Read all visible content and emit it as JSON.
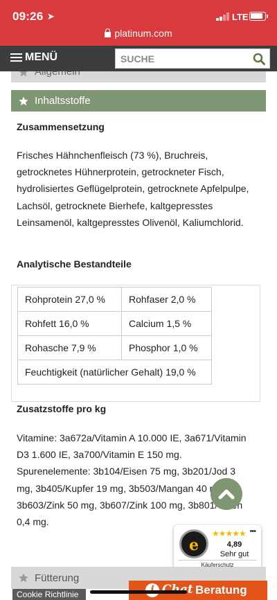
{
  "status_bar": {
    "time": "09:26",
    "location_glyph": "➤",
    "network": "LTE"
  },
  "browser": {
    "url": "platinum.com"
  },
  "nav": {
    "menu_label": "MENÜ",
    "search_placeholder": "SUCHE"
  },
  "accordion": {
    "allgemein": "Allgemein",
    "inhaltsstoffe": "Inhaltsstoffe",
    "fuetterung": "Fütterung"
  },
  "zusammensetzung": {
    "heading": "Zusammensetzung",
    "text": "Frisches Hähnchenfleisch (73 %), Bruchreis, getrocknetes Hühnerprotein, getrockneter Fisch, hydrolisiertes Geflügelprotein, getrocknete Apfelpulpe, Lachsöl, getrocknete Bierhefe, kaltgepresstes Leinsamenöl, kaltgepresstes Olivenöl, Kaliumchlorid."
  },
  "analytische": {
    "heading": "Analytische Bestandteile",
    "rows": [
      [
        "Rohprotein 27,0 %",
        "Rohfaser 2,0 %"
      ],
      [
        "Rohfett 16,0 %",
        "Calcium 1,5 %"
      ],
      [
        "Rohasche 7,9 %",
        "Phosphor 1,0 %"
      ]
    ],
    "full_row": "Feuchtigkeit (natürlicher Gehalt) 19,0 %"
  },
  "zusatzstoffe": {
    "heading": "Zusatzstoffe pro kg",
    "text": "Vitamine: 3a672a/Vitamin A 10.000 IE, 3a671/Vitamin D3 1.600 IE, 3a700/Vitamin E 150 mg. Spurenelemente: 3b104/Eisen 75 mg, 3b201/Jod 3 mg, 3b405/Kupfer 19 mg, 3b503/Mangan 40 mg, 3b603/Zink 50 mg, 3b607/Zink 100 mg, 3b801/Selen 0,4 mg."
  },
  "trusted_shops": {
    "seal_letter": "e",
    "stars": "★★★★★",
    "score": "4,89",
    "rating_label": "Sehr gut",
    "footer": "Käuferschutz"
  },
  "footer": {
    "cookie_label": "Cookie Richtlinie",
    "chat_word_a": "Chat",
    "chat_word_b": "Beratung"
  },
  "colors": {
    "browser_bar": "#d93a3d",
    "nav_bar": "#3d3d3d",
    "accent_green": "#7f9672",
    "chat_orange": "#e3541a"
  }
}
